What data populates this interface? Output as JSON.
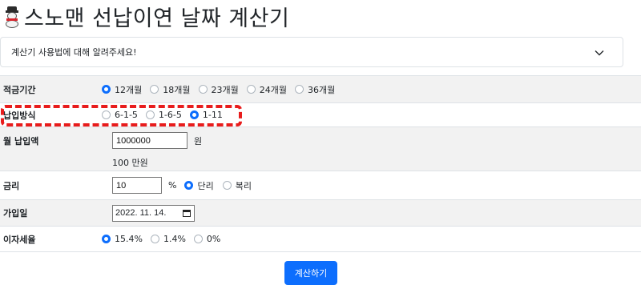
{
  "header": {
    "title": "스노맨 선납이연 날짜 계산기",
    "icon": "snowman-icon"
  },
  "accordion": {
    "label": "계산기 사용법에 대해 알려주세요!",
    "icon": "chevron-down-icon"
  },
  "form": {
    "period": {
      "label": "적금기간",
      "options": [
        "12개월",
        "18개월",
        "23개월",
        "24개월",
        "36개월"
      ],
      "selected": "12개월"
    },
    "method": {
      "label": "납입방식",
      "options": [
        "6-1-5",
        "1-6-5",
        "1-11"
      ],
      "selected": "1-11"
    },
    "monthly": {
      "label": "월 납입액",
      "value": "1000000",
      "unit": "원",
      "helper": "100 만원"
    },
    "rate": {
      "label": "금리",
      "value": "10",
      "unit": "%",
      "options": [
        "단리",
        "복리"
      ],
      "selected": "단리"
    },
    "join_date": {
      "label": "가입일",
      "value": "2022. 11. 14."
    },
    "tax": {
      "label": "이자세율",
      "options": [
        "15.4%",
        "1.4%",
        "0%"
      ],
      "selected": "15.4%"
    }
  },
  "actions": {
    "calculate_label": "계산하기"
  },
  "colors": {
    "accent": "#0d6efd",
    "highlight": "#e81c1c",
    "row_alt": "#f2f2f2",
    "border": "#dee2e6"
  }
}
